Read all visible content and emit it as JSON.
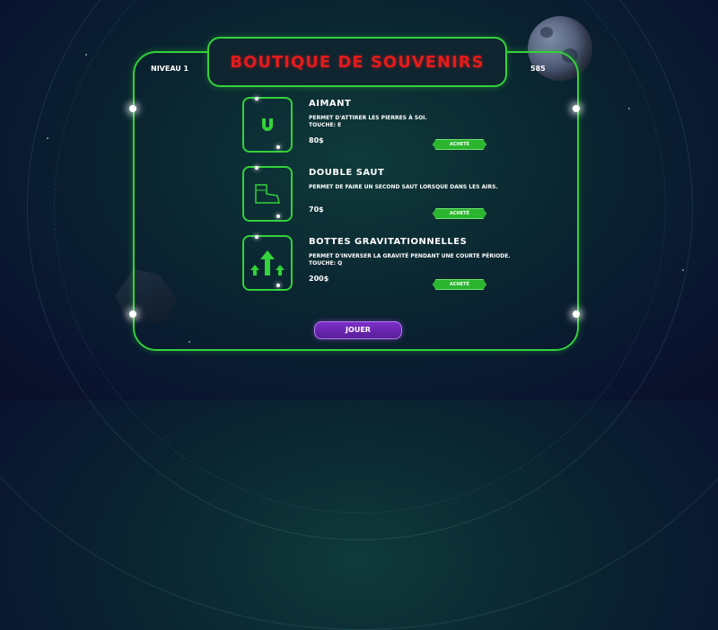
{
  "header": {
    "title": "BOUTIQUE DE SOUVENIRS",
    "level": "NIVEAU 1",
    "score": "585"
  },
  "items": [
    {
      "name": "AIMANT",
      "description": "PERMET D'ATTIRER LES PIERRES À SOI.\nTOUCHE: E",
      "price": "80$",
      "button": "ACHETÉ",
      "icon": "magnet-icon"
    },
    {
      "name": "DOUBLE SAUT",
      "description": "PERMET DE FAIRE UN SECOND SAUT LORSQUE DANS LES AIRS.",
      "price": "70$",
      "button": "ACHETÉ",
      "icon": "boot-icon"
    },
    {
      "name": "BOTTES GRAVITATIONNELLES",
      "description": "PERMET D'INVERSER LA GRAVITÉ PENDANT UNE COURTE PÉRIODE.\nTOUCHE: Q",
      "price": "200$",
      "button": "ACHETÉ",
      "icon": "gravity-arrows-icon"
    }
  ],
  "play_button": "JOUER",
  "colors": {
    "accent_green": "#32d23a",
    "title_red": "#e41b1b",
    "play_purple": "#7c2fc8"
  }
}
